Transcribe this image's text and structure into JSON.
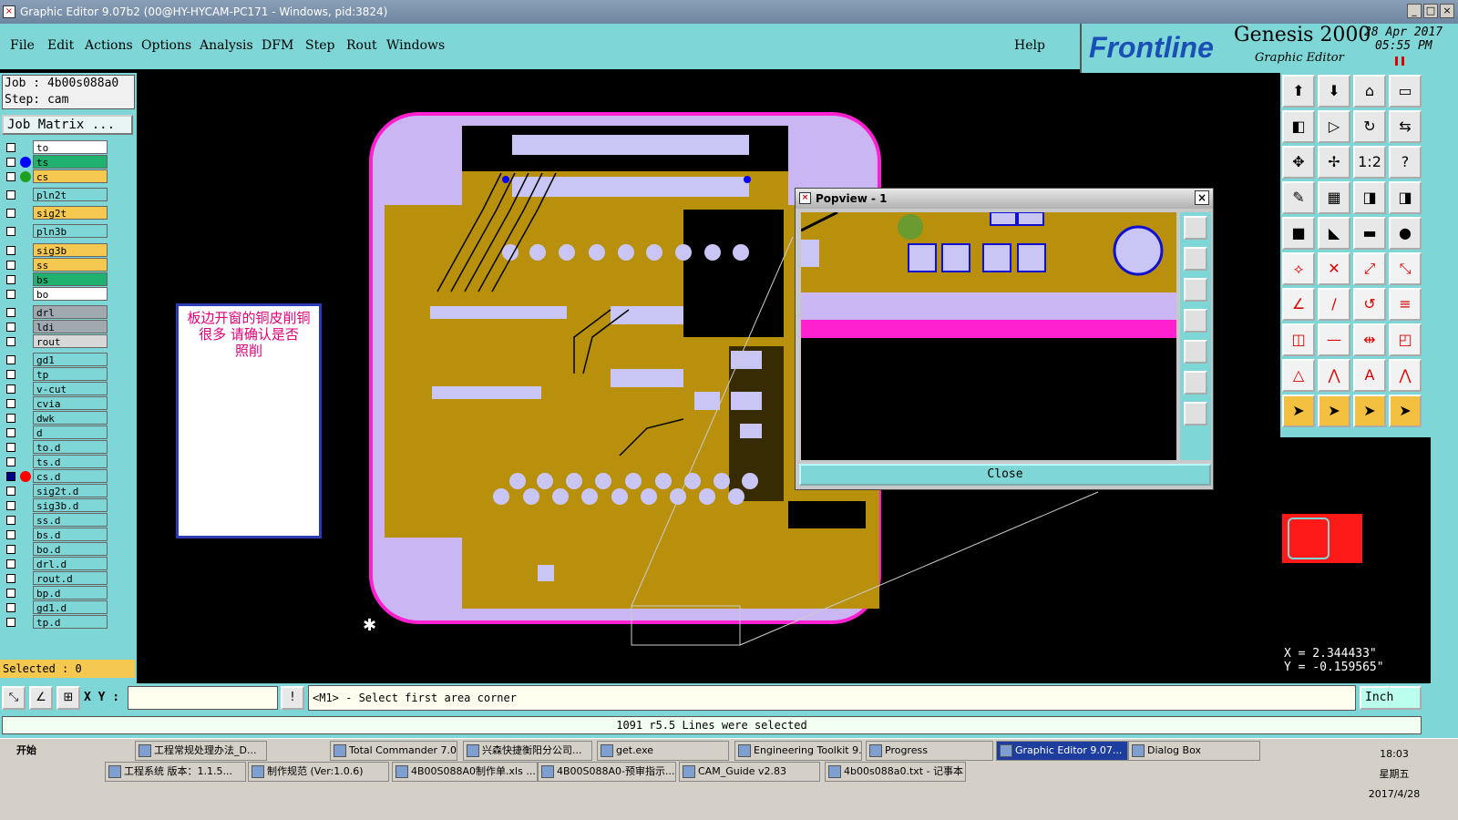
{
  "window": {
    "title": "Graphic Editor 9.07b2 (00@HY-HYCAM-PC171 - Windows, pid:3824)"
  },
  "menu": {
    "items": [
      "File",
      "Edit",
      "Actions",
      "Options",
      "Analysis",
      "DFM",
      "Step",
      "Rout",
      "Windows"
    ],
    "help": "Help"
  },
  "brand": {
    "logo": "Frontline",
    "product": "Genesis 2000",
    "subtitle": "Graphic Editor",
    "date": "28 Apr 2017",
    "time": "05:55 PM"
  },
  "job": {
    "job_line": "Job : 4b00s088a0",
    "step_line": "Step: cam",
    "matrix_button": "Job Matrix ..."
  },
  "layers": [
    {
      "name": "to",
      "color": "#ffffff",
      "dot": ""
    },
    {
      "name": "ts",
      "color": "#20b070",
      "dot": "#0000ff"
    },
    {
      "name": "cs",
      "color": "#f5c850",
      "dot": "#1fa01f"
    },
    {
      "name": "pln2t",
      "color": "#7fd6d6",
      "dot": ""
    },
    {
      "name": "sig2t",
      "color": "#f5c850",
      "dot": ""
    },
    {
      "name": "pln3b",
      "color": "#7fd6d6",
      "dot": ""
    },
    {
      "name": "sig3b",
      "color": "#f5c850",
      "dot": ""
    },
    {
      "name": "ss",
      "color": "#f5c850",
      "dot": ""
    },
    {
      "name": "bs",
      "color": "#20b070",
      "dot": ""
    },
    {
      "name": "bo",
      "color": "#ffffff",
      "dot": ""
    },
    {
      "name": "drl",
      "color": "#a0a8b0",
      "dot": ""
    },
    {
      "name": "ldi",
      "color": "#a0a8b0",
      "dot": ""
    },
    {
      "name": "rout",
      "color": "#d8d8d8",
      "dot": ""
    },
    {
      "name": "gd1",
      "color": "#7fd6d6",
      "dot": ""
    },
    {
      "name": "tp",
      "color": "#7fd6d6",
      "dot": ""
    },
    {
      "name": "v-cut",
      "color": "#7fd6d6",
      "dot": ""
    },
    {
      "name": "cvia",
      "color": "#7fd6d6",
      "dot": ""
    },
    {
      "name": "dwk",
      "color": "#7fd6d6",
      "dot": ""
    },
    {
      "name": "d",
      "color": "#7fd6d6",
      "dot": ""
    },
    {
      "name": "to.d",
      "color": "#7fd6d6",
      "dot": ""
    },
    {
      "name": "ts.d",
      "color": "#7fd6d6",
      "dot": ""
    },
    {
      "name": "cs.d",
      "color": "#7fd6d6",
      "dot": "#ff0000"
    },
    {
      "name": "sig2t.d",
      "color": "#7fd6d6",
      "dot": ""
    },
    {
      "name": "sig3b.d",
      "color": "#7fd6d6",
      "dot": ""
    },
    {
      "name": "ss.d",
      "color": "#7fd6d6",
      "dot": ""
    },
    {
      "name": "bs.d",
      "color": "#7fd6d6",
      "dot": ""
    },
    {
      "name": "bo.d",
      "color": "#7fd6d6",
      "dot": ""
    },
    {
      "name": "drl.d",
      "color": "#7fd6d6",
      "dot": ""
    },
    {
      "name": "rout.d",
      "color": "#7fd6d6",
      "dot": ""
    },
    {
      "name": "bp.d",
      "color": "#7fd6d6",
      "dot": ""
    },
    {
      "name": "gd1.d",
      "color": "#7fd6d6",
      "dot": ""
    },
    {
      "name": "tp.d",
      "color": "#7fd6d6",
      "dot": ""
    }
  ],
  "selected": "Selected : 0",
  "note": {
    "line1": "板边开窗的铜皮削铜",
    "line2": "很多 请确认是否",
    "line3": "照削"
  },
  "popview": {
    "title": "Popview - 1",
    "close_button": "Close"
  },
  "coords": {
    "x": "X = 2.344433\"",
    "y": "Y = -0.159565\""
  },
  "command": {
    "xy_label": "X Y :",
    "prompt": "<M1> - Select first area corner",
    "unit": "Inch"
  },
  "status": {
    "message": "1091 r5.5 Lines were selected"
  },
  "taskbar": {
    "start": "开始",
    "row1": [
      "工程常规处理办法_D...",
      "Total Commander 7.0 ...",
      "兴森快捷衡阳分公司...",
      "get.exe",
      "Engineering Toolkit 9....",
      "Progress",
      "Graphic Editor 9.07...",
      "Dialog Box"
    ],
    "row2": [
      "工程系统 版本：1.1.5...",
      "制作规范 (Ver:1.0.6)",
      "4B00S088A0制作单.xls ...",
      "4B00S088A0-预审指示....",
      "CAM_Guide v2.83",
      "4b00s088a0.txt - 记事本"
    ],
    "time": "18:03",
    "weekday": "星期五",
    "date": "2017/4/28"
  },
  "colors": {
    "board_purple": "#c9b6f2",
    "copper": "#b8900c",
    "pad": "#c9c6f5",
    "panel_cyan": "#7fd6d6",
    "magenta_edge": "#ff20d0"
  }
}
